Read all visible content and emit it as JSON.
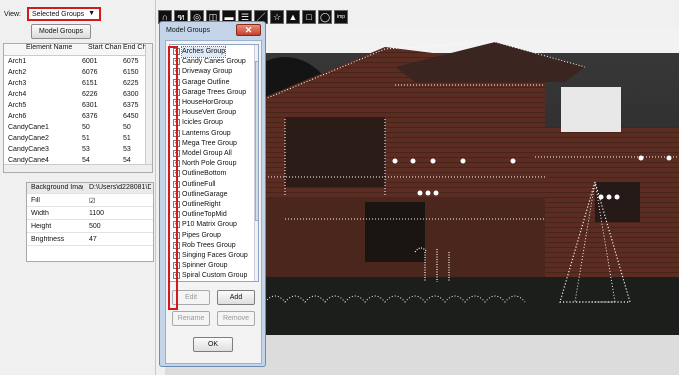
{
  "view": {
    "label": "View:",
    "selected": "Selected Groups",
    "arrow": "▼"
  },
  "model_groups_button": "Model Groups",
  "model_table": {
    "columns": [
      "Element Name",
      "Start Chan",
      "End Cha"
    ],
    "rows": [
      [
        "Arch1",
        "6001",
        "6075"
      ],
      [
        "Arch2",
        "6076",
        "6150"
      ],
      [
        "Arch3",
        "6151",
        "6225"
      ],
      [
        "Arch4",
        "6226",
        "6300"
      ],
      [
        "Arch5",
        "6301",
        "6375"
      ],
      [
        "Arch6",
        "6376",
        "6450"
      ],
      [
        "CandyCane1",
        "50",
        "50"
      ],
      [
        "CandyCane2",
        "51",
        "51"
      ],
      [
        "CandyCane3",
        "53",
        "53"
      ],
      [
        "CandyCane4",
        "54",
        "54"
      ]
    ]
  },
  "properties": [
    {
      "key": "Background Image",
      "value": "D:\\Users\\d228081\\Do"
    },
    {
      "key": "Fill",
      "value": "☑"
    },
    {
      "key": "Width",
      "value": "1100"
    },
    {
      "key": "Height",
      "value": "500"
    },
    {
      "key": "Brightness",
      "value": "47"
    }
  ],
  "toolbar": {
    "tools": [
      "arch-tool-icon",
      "candy-cane-tool-icon",
      "circle-tool-icon",
      "single-line-tool-icon",
      "matrix-tool-icon",
      "matrix-lines-tool-icon",
      "line-tool-icon",
      "star-tool-icon",
      "tree-tool-icon",
      "rectangle-tool-icon",
      "sphere-tool-icon",
      "import-tool-icon"
    ],
    "glyphs": [
      "∩",
      "ฑ",
      "◎",
      "◫",
      "▬",
      "☰",
      "／",
      "☆",
      "▲",
      "□",
      "◯",
      "imp"
    ]
  },
  "dialog": {
    "title": "Model Groups",
    "close": "✕",
    "groups": [
      "Arches Group",
      "Candy Canes Group",
      "Driveway Group",
      "Garage Outline",
      "Garage Trees Group",
      "HouseHorGroup",
      "HouseVert Group",
      "Icicles Group",
      "Lanterns Group",
      "Mega Tree Group",
      "Model Group All",
      "North Pole Group",
      "OutlineBottom",
      "OutlineFull",
      "OutlineGarage",
      "OutlineRight",
      "OutlineTopMid",
      "P10 Matrix Group",
      "Pipes Group",
      "Rob Trees Group",
      "Singing Faces Group",
      "Spinner Group",
      "Spiral Custom Group"
    ],
    "checkmark": "✓",
    "buttons": {
      "edit": "Edit",
      "add": "Add",
      "rename": "Rename",
      "remove": "Remove",
      "ok": "OK"
    }
  },
  "colors": {
    "highlight": "#d21a1a",
    "dialog_frame": "#c4d5ea",
    "canvas": "#2a2a2a"
  }
}
